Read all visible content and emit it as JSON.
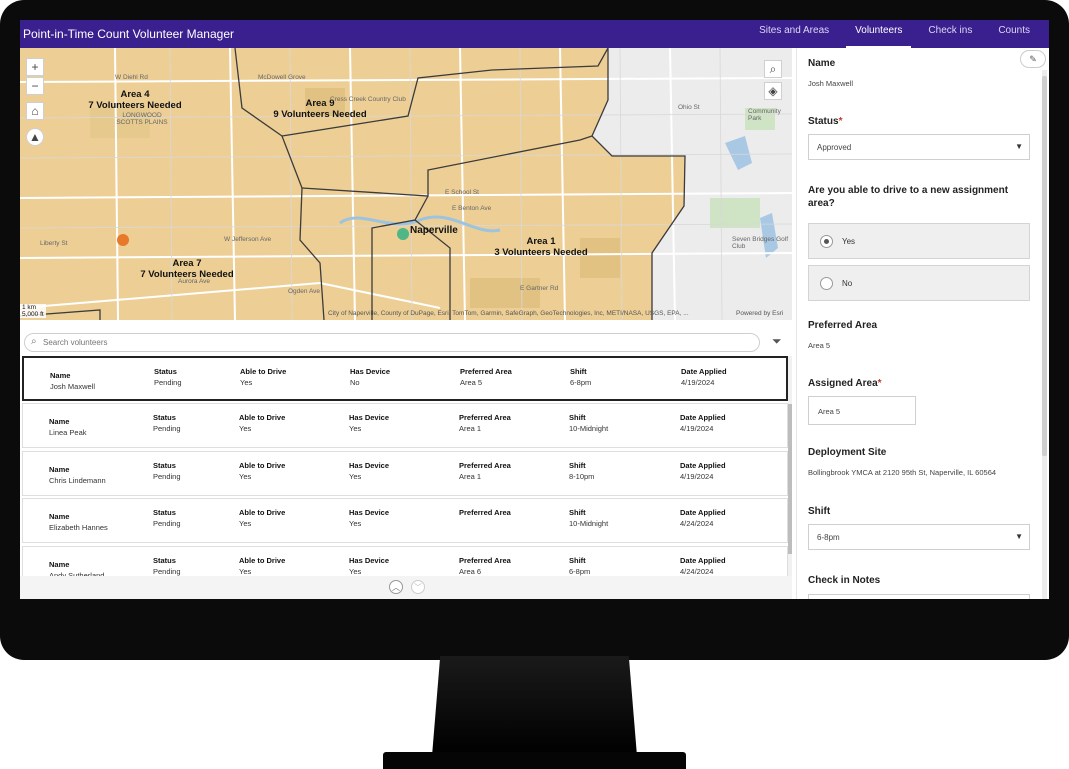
{
  "app": {
    "title": "Point-in-Time Count Volunteer Manager"
  },
  "nav": [
    {
      "label": "Sites and Areas",
      "active": false
    },
    {
      "label": "Volunteers",
      "active": true
    },
    {
      "label": "Check ins",
      "active": false
    },
    {
      "label": "Counts",
      "active": false
    }
  ],
  "map": {
    "zoom_in": "+",
    "zoom_out": "−",
    "areas": [
      {
        "name": "Area 4",
        "needed": "7 Volunteers Needed"
      },
      {
        "name": "Area 9",
        "needed": "9 Volunteers Needed"
      },
      {
        "name": "Area 1",
        "needed": "3 Volunteers Needed"
      },
      {
        "name": "Area 7",
        "needed": "7 Volunteers Needed"
      }
    ],
    "city_label": "Naperville",
    "places": [
      "LONGWOOD SCOTTS PLAINS",
      "Community Park",
      "Seven Bridges Golf Club",
      "McDowell Grove",
      "Cress Creek Country Club",
      "W Diehl Rd",
      "Ohio St",
      "E School St",
      "E Benton Ave",
      "W Jefferson Ave",
      "Liberty St",
      "Aurora Ave",
      "Ogden Ave",
      "E Gartner Rd"
    ],
    "attribution": "City of Naperville, County of DuPage, Esri, TomTom, Garmin, SafeGraph, GeoTechnologies, Inc, METI/NASA, USGS, EPA, ...",
    "powered_by": "Powered by Esri",
    "scale_km": "1 km",
    "scale_ft": "5,000 ft",
    "colors": {
      "area_fill": "#edcf96",
      "base": "#ececec",
      "road": "#ffffff",
      "boundary": "#3b3b3b"
    }
  },
  "search": {
    "placeholder": "Search volunteers"
  },
  "list": {
    "headers": {
      "name": "Name",
      "status": "Status",
      "drive": "Able to Drive",
      "device": "Has Device",
      "area": "Preferred Area",
      "shift": "Shift",
      "date": "Date Applied"
    },
    "rows": [
      {
        "name": "Josh  Maxwell",
        "status": "Pending",
        "drive": "Yes",
        "device": "No",
        "area": "Area 5",
        "shift": "6-8pm",
        "date": "4/19/2024",
        "selected": true
      },
      {
        "name": "Linea Peak",
        "status": "Pending",
        "drive": "Yes",
        "device": "Yes",
        "area": "Area 1",
        "shift": "10-Midnight",
        "date": "4/19/2024",
        "selected": false
      },
      {
        "name": "Chris Lindemann",
        "status": "Pending",
        "drive": "Yes",
        "device": "Yes",
        "area": "Area 1",
        "shift": "8-10pm",
        "date": "4/19/2024",
        "selected": false
      },
      {
        "name": "Elizabeth Hannes",
        "status": "Pending",
        "drive": "Yes",
        "device": "Yes",
        "area": "",
        "shift": "10-Midnight",
        "date": "4/24/2024",
        "selected": false
      },
      {
        "name": "Andy  Sutherland",
        "status": "Pending",
        "drive": "Yes",
        "device": "Yes",
        "area": "Area 6",
        "shift": "6-8pm",
        "date": "4/24/2024",
        "selected": false
      }
    ]
  },
  "panel": {
    "name_label": "Name",
    "name_value": "Josh  Maxwell",
    "status_label": "Status",
    "status_value": "Approved",
    "drive_question": "Are you able to drive to a new assignment area?",
    "drive_options": [
      {
        "label": "Yes",
        "checked": true
      },
      {
        "label": "No",
        "checked": false
      }
    ],
    "preferred_label": "Preferred Area",
    "preferred_value": "Area 5",
    "assigned_label": "Assigned Area",
    "assigned_value": "Area 5",
    "site_label": "Deployment Site",
    "site_value": "Bollingbrook YMCA at 2120 95th St, Naperville, IL 60564",
    "shift_label": "Shift",
    "shift_value": "6-8pm",
    "notes_label": "Check in Notes",
    "required_mark": "*"
  }
}
